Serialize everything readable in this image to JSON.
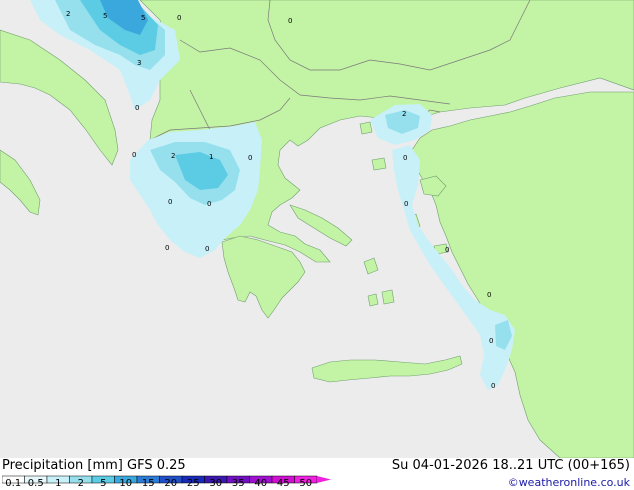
{
  "map": {
    "colors": {
      "sea": "#ececec",
      "land": "#c3f3a4",
      "border": "#7a7a7a",
      "precip_light": "#c8f0f8",
      "precip_mid": "#96e0ee",
      "precip_strong": "#5ccbe4",
      "precip_heavy": "#3aa8dc"
    },
    "contour_labels": [
      {
        "text": "2"
      },
      {
        "text": "5"
      },
      {
        "text": "5"
      },
      {
        "text": "0"
      },
      {
        "text": "0"
      },
      {
        "text": "3"
      },
      {
        "text": "0"
      },
      {
        "text": "2"
      },
      {
        "text": "0"
      },
      {
        "text": "2"
      },
      {
        "text": "1"
      },
      {
        "text": "0"
      },
      {
        "text": "0"
      },
      {
        "text": "0"
      },
      {
        "text": "0"
      },
      {
        "text": "0"
      },
      {
        "text": "0"
      },
      {
        "text": "0"
      },
      {
        "text": "0"
      },
      {
        "text": "0"
      },
      {
        "text": "0"
      },
      {
        "text": "0"
      }
    ]
  },
  "footer": {
    "title": "Precipitation [mm]  GFS 0.25",
    "datetime": "Su 04-01-2026 18..21 UTC (00+165)",
    "credit": "©weatheronline.co.uk",
    "scale_ticks": [
      "0.1",
      "0.5",
      "1",
      "2",
      "5",
      "10",
      "15",
      "20",
      "25",
      "30",
      "35",
      "40",
      "45",
      "50"
    ],
    "scale_colors": [
      "#ffffff",
      "#e6f8fc",
      "#c8f0f8",
      "#96e0ee",
      "#5ccbe4",
      "#3aa8dc",
      "#2c7cd6",
      "#2050c8",
      "#1a2ab8",
      "#3a18b0",
      "#7010c0",
      "#a010d0",
      "#d010d0",
      "#f020e0"
    ]
  }
}
